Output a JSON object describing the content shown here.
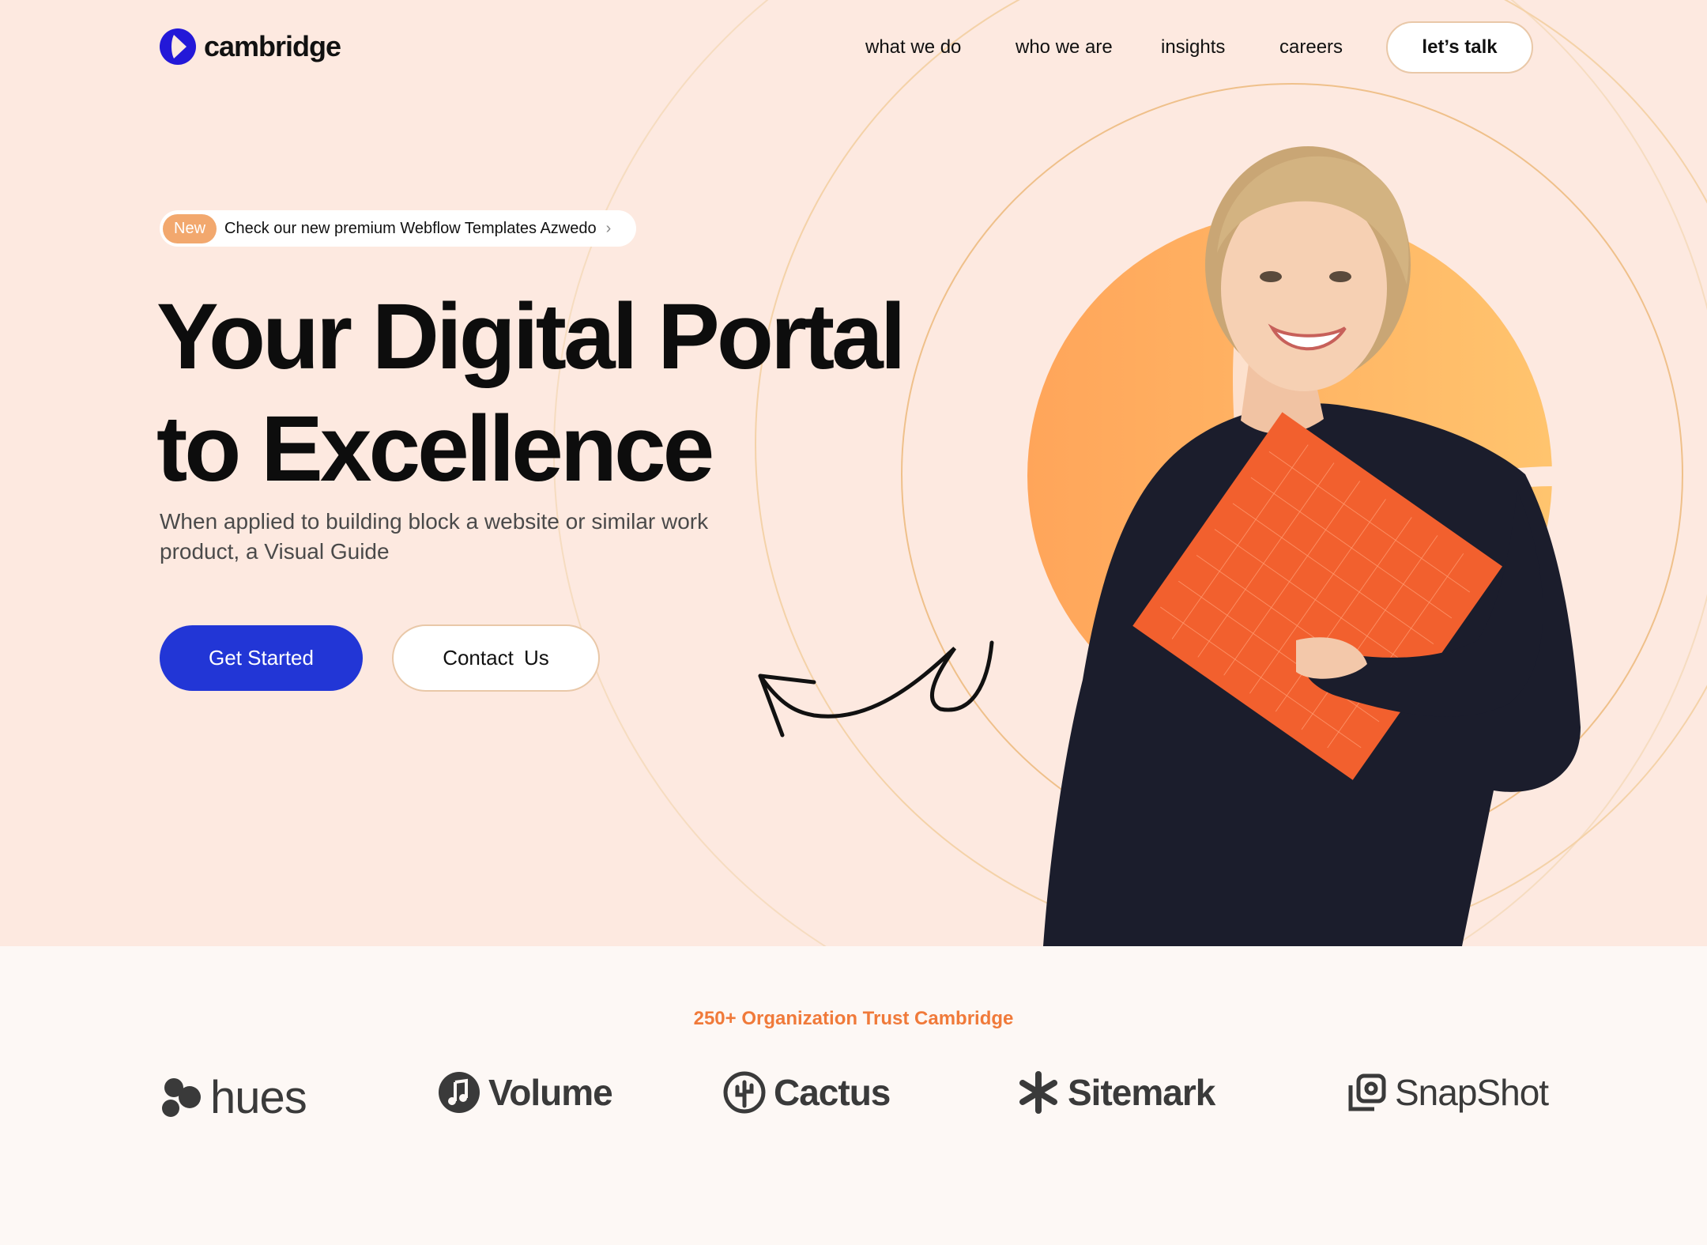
{
  "brand": {
    "name": "cambridge"
  },
  "nav": {
    "links": [
      "what we do",
      "who we are",
      "insights",
      "careers"
    ],
    "cta": "let’s talk"
  },
  "hero": {
    "badge_pill": "New",
    "badge_text": "Check our new premium Webflow Templates Azwedo",
    "headline_line1": "Your Digital Portal",
    "headline_line2": "to Excellence",
    "subtitle": "When applied to building block a website or similar work product, a Visual Guide",
    "primary_button": "Get Started",
    "secondary_button": "Contact  Us"
  },
  "trust": {
    "title": "250+ Organization Trust Cambridge",
    "logos": [
      {
        "name": "hues",
        "icon": "hues-blob-icon"
      },
      {
        "name": "Volume",
        "icon": "music-note-icon"
      },
      {
        "name": "Cactus",
        "icon": "cactus-icon"
      },
      {
        "name": "Sitemark",
        "icon": "asterisk-icon"
      },
      {
        "name": "SnapShot",
        "icon": "snapshot-icon"
      }
    ]
  },
  "colors": {
    "hero_bg": "#fde9e0",
    "page_bg": "#fdf8f5",
    "primary": "#2236d6",
    "accent_orange": "#f07a3a",
    "ring": "#f2cfa0"
  }
}
